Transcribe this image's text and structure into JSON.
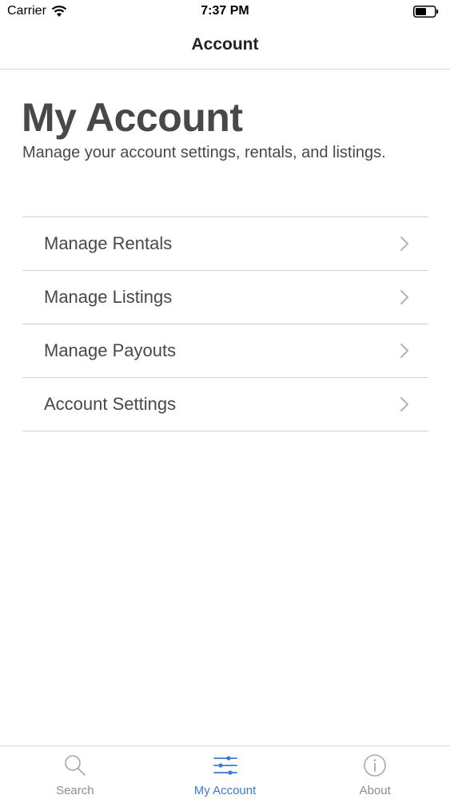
{
  "status_bar": {
    "carrier": "Carrier",
    "time": "7:37 PM",
    "icons": [
      "wifi-icon",
      "battery-icon"
    ]
  },
  "nav": {
    "title": "Account"
  },
  "header": {
    "title": "My Account",
    "subtitle": "Manage your account settings, rentals, and listings."
  },
  "menu": {
    "items": [
      {
        "label": "Manage Rentals",
        "icon": "chevron-right-icon"
      },
      {
        "label": "Manage Listings",
        "icon": "chevron-right-icon"
      },
      {
        "label": "Manage Payouts",
        "icon": "chevron-right-icon"
      },
      {
        "label": "Account Settings",
        "icon": "chevron-right-icon"
      }
    ]
  },
  "tab_bar": {
    "active_index": 1,
    "tabs": [
      {
        "label": "Search",
        "icon": "search-icon"
      },
      {
        "label": "My Account",
        "icon": "sliders-icon"
      },
      {
        "label": "About",
        "icon": "info-icon"
      }
    ]
  },
  "colors": {
    "accent": "#3a7bd5",
    "text": "#484848",
    "inactive": "#8e8e8e",
    "divider": "#cfcfcf"
  }
}
